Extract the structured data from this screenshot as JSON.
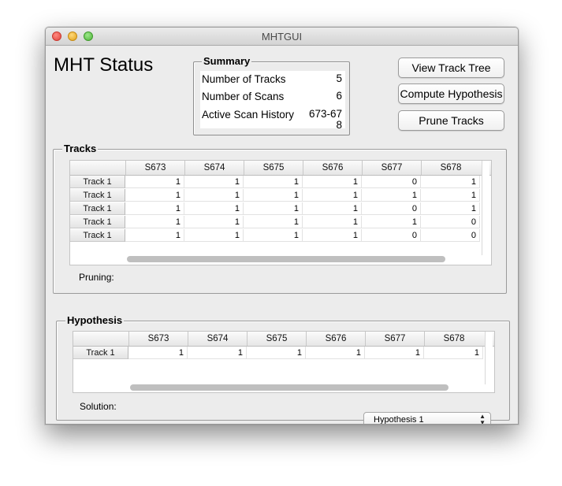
{
  "window": {
    "title": "MHTGUI"
  },
  "header": {
    "title": "MHT Status"
  },
  "summary": {
    "title": "Summary",
    "rows": [
      {
        "label": "Number of Tracks",
        "value": "5"
      },
      {
        "label": "Number of Scans",
        "value": "6"
      },
      {
        "label": "Active Scan History",
        "value": "673-678"
      }
    ]
  },
  "buttons": {
    "view_track_tree": "View Track Tree",
    "compute_hypothesis": "Compute Hypothesis",
    "prune_tracks": "Prune Tracks"
  },
  "tracks": {
    "title": "Tracks",
    "columns": [
      "S673",
      "S674",
      "S675",
      "S676",
      "S677",
      "S678"
    ],
    "rows": [
      {
        "label": "Track 1",
        "values": [
          "1",
          "1",
          "1",
          "1",
          "0",
          "1"
        ]
      },
      {
        "label": "Track 1",
        "values": [
          "1",
          "1",
          "1",
          "1",
          "1",
          "1"
        ]
      },
      {
        "label": "Track 1",
        "values": [
          "1",
          "1",
          "1",
          "1",
          "0",
          "1"
        ]
      },
      {
        "label": "Track 1",
        "values": [
          "1",
          "1",
          "1",
          "1",
          "1",
          "0"
        ]
      },
      {
        "label": "Track 1",
        "values": [
          "1",
          "1",
          "1",
          "1",
          "0",
          "0"
        ]
      }
    ],
    "pruning_label": "Pruning:"
  },
  "hypothesis": {
    "title": "Hypothesis",
    "columns": [
      "S673",
      "S674",
      "S675",
      "S676",
      "S677",
      "S678"
    ],
    "rows": [
      {
        "label": "Track 1",
        "values": [
          "1",
          "1",
          "1",
          "1",
          "1",
          "1"
        ]
      }
    ],
    "solution_label": "Solution:",
    "selected": "Hypothesis 1"
  }
}
